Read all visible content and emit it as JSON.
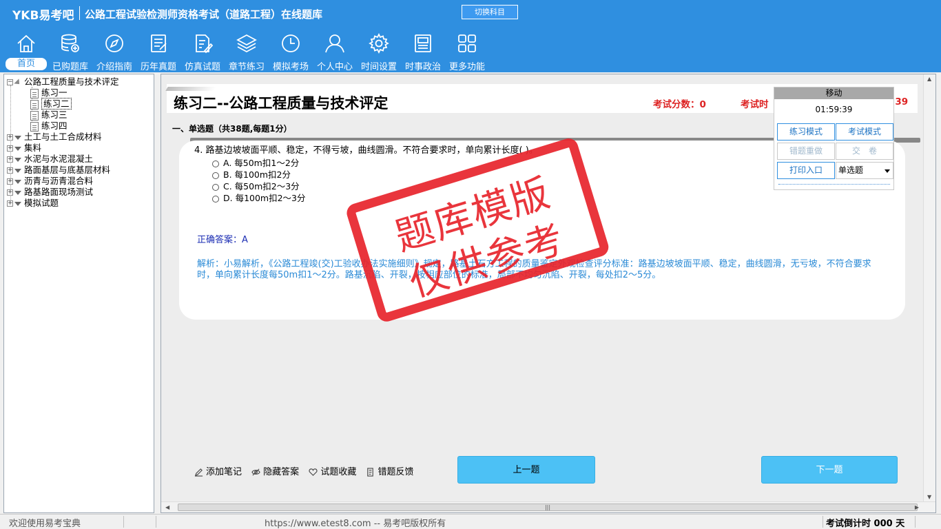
{
  "header": {
    "logo": "YKB易考吧",
    "title": "公路工程试验检测师资格考试（道路工程）在线题库",
    "switch_subject": "切换科目"
  },
  "nav": [
    {
      "label": "首页",
      "icon": "home-icon",
      "active": true
    },
    {
      "label": "已购题库",
      "icon": "database-icon"
    },
    {
      "label": "介绍指南",
      "icon": "compass-icon"
    },
    {
      "label": "历年真题",
      "icon": "list-doc-icon"
    },
    {
      "label": "仿真试题",
      "icon": "edit-doc-icon"
    },
    {
      "label": "章节练习",
      "icon": "layers-icon"
    },
    {
      "label": "模拟考场",
      "icon": "clock-icon"
    },
    {
      "label": "个人中心",
      "icon": "user-icon"
    },
    {
      "label": "时间设置",
      "icon": "gear-icon"
    },
    {
      "label": "时事政治",
      "icon": "news-icon"
    },
    {
      "label": "更多功能",
      "icon": "grid-icon"
    }
  ],
  "tree": {
    "root": "公路工程质量与技术评定",
    "children": [
      "练习一",
      "练习二",
      "练习三",
      "练习四"
    ],
    "selected": "练习二",
    "others": [
      "土工与土工合成材料",
      "集料",
      "水泥与水泥混凝土",
      "路面基层与底基层材料",
      "沥青与沥青混合料",
      "路基路面现场测试",
      "模拟试题"
    ]
  },
  "main": {
    "page_title": "练习二--公路工程质量与技术评定",
    "score_label": "考试分数：0",
    "time_label": "考试时",
    "time_tail": ":39",
    "section_title": "一、单选题（共38题,每题1分）",
    "question": "4. 路基边坡坡面平顺、稳定，不得亏坡，曲线圆滑。不符合要求时，单向累计长度(  )。",
    "options": [
      "A. 每50m扣1～2分",
      "B. 每100m扣2分",
      "C. 每50m扣2～3分",
      "D. 每100m扣2～3分"
    ],
    "answer": "正确答案：A",
    "analysis": "解析：小易解析，《公路工程竣(交)工验收办法实施细则》规定，路基土石方工程的质量鉴定外观检查评分标准：路基边坡坡面平顺、稳定，曲线圆滑，无亏坡，不符合要求时，单向累计长度每50m扣1～2分。路基沉陷、开裂，按相应部位的标准，局部不均匀沉陷、开裂，每处扣2～5分。",
    "actions": [
      "添加笔记",
      "隐藏答案",
      "试题收藏",
      "错题反馈"
    ],
    "prev": "上一题",
    "next": "下一题"
  },
  "panel": {
    "header": "移动",
    "timer": "01:59:39",
    "practice_mode": "练习模式",
    "exam_mode": "考试模式",
    "redo_wrong": "错题重做",
    "submit": "交　卷",
    "print": "打印入口",
    "question_type": "单选题"
  },
  "stamp": {
    "line1": "题库模版",
    "line2": "仅供参考"
  },
  "status": {
    "welcome": "欢迎使用易考宝典",
    "url": "https://www.etest8.com -- 易考吧版权所有",
    "countdown": "考试倒计时 000 天"
  },
  "colors": {
    "header_bg": "#2f8fe0",
    "accent_red": "#d22222",
    "answer_blue": "#1b2db3",
    "analysis_blue": "#2a8ad6",
    "button_cyan": "#4cc1f5",
    "stamp_red": "#e8242c"
  }
}
